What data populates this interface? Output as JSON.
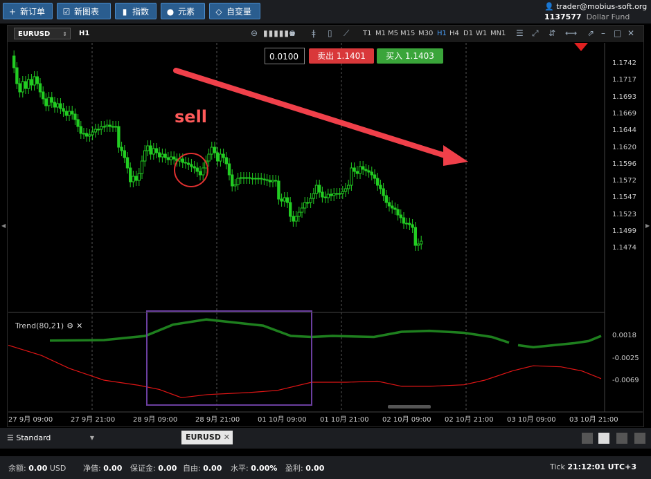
{
  "toolbar": {
    "new_order": "新订单",
    "new_chart": "新图表",
    "indicators": "指数",
    "elements": "元素",
    "variables": "自变量"
  },
  "account": {
    "email": "trader@mobius-soft.org",
    "id": "1137577",
    "fund": "Dollar Fund"
  },
  "chart": {
    "symbol": "EURUSD",
    "period": "H1",
    "timeframes": [
      "T1",
      "M1",
      "M5",
      "M15",
      "M30",
      "H1",
      "H4",
      "D1",
      "W1",
      "MN1"
    ],
    "active_timeframe": "H1",
    "lot": "0.0100",
    "sell_label": "卖出 1.1401",
    "buy_label": "买入 1.1403",
    "annotation": "sell",
    "price_labels": [
      "1.1742",
      "1.1717",
      "1.1693",
      "1.1669",
      "1.1644",
      "1.1620",
      "1.1596",
      "1.1572",
      "1.1547",
      "1.1523",
      "1.1499",
      "1.1474"
    ],
    "indicator_name": "Trend(80,21)",
    "indicator_labels": [
      "0.0018",
      "-0.0025",
      "-0.0069"
    ],
    "time_labels": [
      "27 9月 09:00",
      "27 9月 21:00",
      "28 9月 09:00",
      "28 9月 21:00",
      "01 10月 09:00",
      "01 10月 21:00",
      "02 10月 09:00",
      "02 10月 21:00",
      "03 10月 09:00",
      "03 10月 21:00"
    ]
  },
  "tabs": {
    "layout": "Standard",
    "active_tab": "EURUSD"
  },
  "status": {
    "balance_label": "余额:",
    "balance": "0.00",
    "currency": "USD",
    "equity_label": "净值:",
    "equity": "0.00",
    "margin_label": "保证金:",
    "margin": "0.00",
    "free_label": "自由:",
    "free": "0.00",
    "level_label": "水平:",
    "level": "0.00%",
    "profit_label": "盈利:",
    "profit": "0.00",
    "mode": "Tick",
    "time": "21:12:01",
    "timezone": "UTC+3"
  },
  "colors": {
    "bull": "#22cc22",
    "trend_green": "#1e7f1e",
    "trend_red": "#e01515",
    "arrow": "#f0404a",
    "highlight_box": "#6b3fa0",
    "sell": "#d9383a",
    "buy": "#3aa53a"
  }
}
